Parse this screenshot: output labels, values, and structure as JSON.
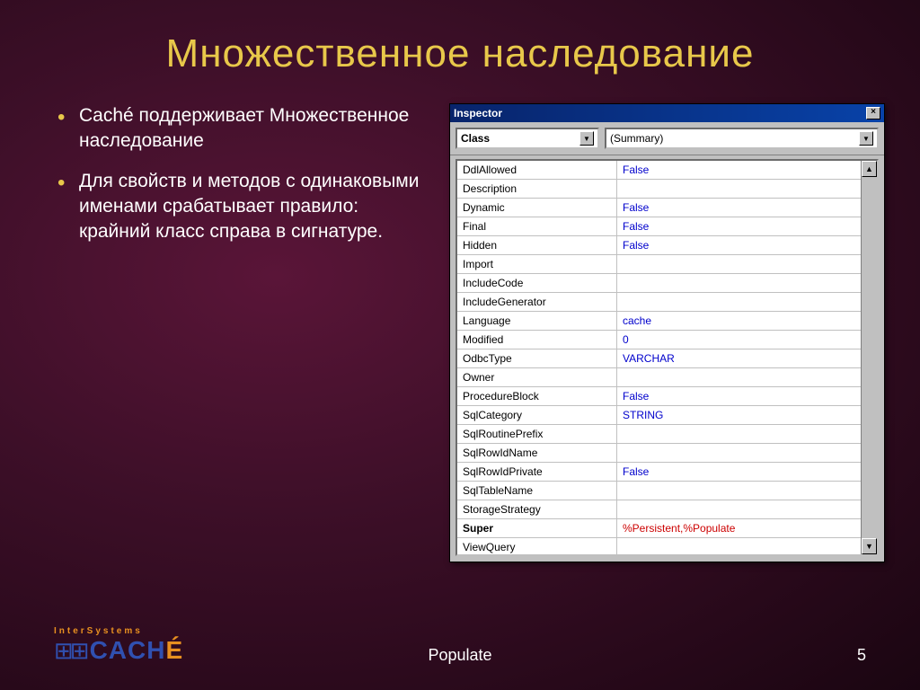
{
  "title": "Множественное наследование",
  "bullets": [
    "Caché поддерживает Множественное наследование",
    "Для свойств и методов с одинаковыми именами срабатывает правило: крайний класс справа в сигнатуре."
  ],
  "inspector": {
    "window_title": "Inspector",
    "dropdown_left": "Class",
    "dropdown_right": "(Summary)",
    "rows": [
      {
        "name": "DdlAllowed",
        "value": "False",
        "bold": false,
        "red": false
      },
      {
        "name": "Description",
        "value": "",
        "bold": false,
        "red": false
      },
      {
        "name": "Dynamic",
        "value": "False",
        "bold": false,
        "red": false
      },
      {
        "name": "Final",
        "value": "False",
        "bold": false,
        "red": false
      },
      {
        "name": "Hidden",
        "value": "False",
        "bold": false,
        "red": false
      },
      {
        "name": "Import",
        "value": "",
        "bold": false,
        "red": false
      },
      {
        "name": "IncludeCode",
        "value": "",
        "bold": false,
        "red": false
      },
      {
        "name": "IncludeGenerator",
        "value": "",
        "bold": false,
        "red": false
      },
      {
        "name": "Language",
        "value": "cache",
        "bold": false,
        "red": false
      },
      {
        "name": "Modified",
        "value": "0",
        "bold": false,
        "red": false
      },
      {
        "name": "OdbcType",
        "value": "VARCHAR",
        "bold": false,
        "red": false
      },
      {
        "name": "Owner",
        "value": "",
        "bold": false,
        "red": false
      },
      {
        "name": "ProcedureBlock",
        "value": "False",
        "bold": false,
        "red": false
      },
      {
        "name": "SqlCategory",
        "value": "STRING",
        "bold": false,
        "red": false
      },
      {
        "name": "SqlRoutinePrefix",
        "value": "",
        "bold": false,
        "red": false
      },
      {
        "name": "SqlRowIdName",
        "value": "",
        "bold": false,
        "red": false
      },
      {
        "name": "SqlRowIdPrivate",
        "value": "False",
        "bold": false,
        "red": false
      },
      {
        "name": "SqlTableName",
        "value": "",
        "bold": false,
        "red": false
      },
      {
        "name": "StorageStrategy",
        "value": "",
        "bold": false,
        "red": false
      },
      {
        "name": "Super",
        "value": "%Persistent,%Populate",
        "bold": true,
        "red": true
      },
      {
        "name": "ViewQuery",
        "value": "",
        "bold": false,
        "red": false
      }
    ]
  },
  "footer": {
    "logo_top": "InterSystems",
    "logo_text_a": "CACH",
    "logo_text_b": "É",
    "center": "Populate",
    "page": "5"
  }
}
